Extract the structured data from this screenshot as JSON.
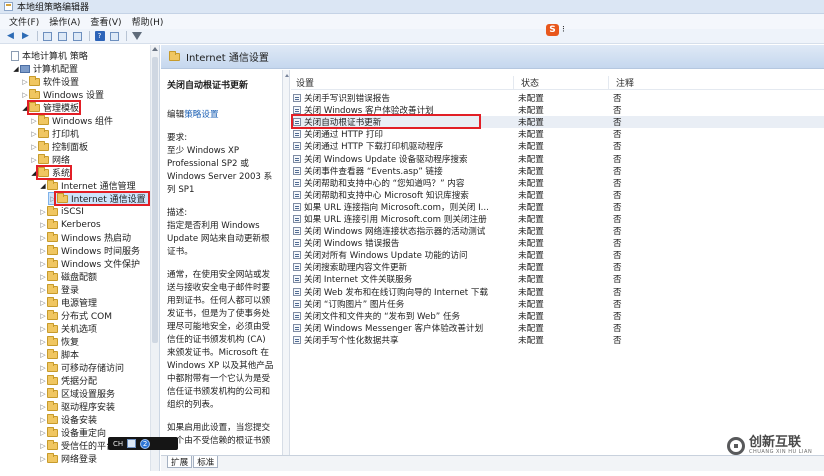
{
  "window": {
    "title": "本地组策略编辑器"
  },
  "menu": [
    "文件(F)",
    "操作(A)",
    "查看(V)",
    "帮助(H)"
  ],
  "ime": {
    "label": "S",
    "arrow": "⁝"
  },
  "tree": {
    "items": [
      {
        "label": "本地计算机 策略",
        "level": 0,
        "icon": "doc-icon"
      },
      {
        "label": "计算机配置",
        "level": 1,
        "icon": "computer-icon",
        "expanded": true
      },
      {
        "label": "软件设置",
        "level": 2,
        "icon": "folder-icon"
      },
      {
        "label": "Windows 设置",
        "level": 2,
        "icon": "folder-icon"
      },
      {
        "label": "管理模板",
        "level": 2,
        "icon": "folder-icon",
        "expanded": true
      },
      {
        "label": "Windows 组件",
        "level": 3,
        "icon": "folder-icon"
      },
      {
        "label": "打印机",
        "level": 3,
        "icon": "folder-icon"
      },
      {
        "label": "控制面板",
        "level": 3,
        "icon": "folder-icon"
      },
      {
        "label": "网络",
        "level": 3,
        "icon": "folder-icon"
      },
      {
        "label": "系统",
        "level": 3,
        "icon": "folder-icon",
        "expanded": true
      },
      {
        "label": "Internet 通信管理",
        "level": 4,
        "icon": "folder-icon",
        "expanded": true
      },
      {
        "label": "Internet 通信设置",
        "level": 5,
        "icon": "folder-icon",
        "selected": true
      },
      {
        "label": "iSCSI",
        "level": 4,
        "icon": "folder-icon"
      },
      {
        "label": "Kerberos",
        "level": 4,
        "icon": "folder-icon"
      },
      {
        "label": "Windows 热启动",
        "level": 4,
        "icon": "folder-icon"
      },
      {
        "label": "Windows 时间服务",
        "level": 4,
        "icon": "folder-icon"
      },
      {
        "label": "Windows 文件保护",
        "level": 4,
        "icon": "folder-icon"
      },
      {
        "label": "磁盘配额",
        "level": 4,
        "icon": "folder-icon"
      },
      {
        "label": "登录",
        "level": 4,
        "icon": "folder-icon"
      },
      {
        "label": "电源管理",
        "level": 4,
        "icon": "folder-icon"
      },
      {
        "label": "分布式 COM",
        "level": 4,
        "icon": "folder-icon"
      },
      {
        "label": "关机选项",
        "level": 4,
        "icon": "folder-icon"
      },
      {
        "label": "恢复",
        "level": 4,
        "icon": "folder-icon"
      },
      {
        "label": "脚本",
        "level": 4,
        "icon": "folder-icon"
      },
      {
        "label": "可移动存储访问",
        "level": 4,
        "icon": "folder-icon"
      },
      {
        "label": "凭据分配",
        "level": 4,
        "icon": "folder-icon"
      },
      {
        "label": "区域设置服务",
        "level": 4,
        "icon": "folder-icon"
      },
      {
        "label": "驱动程序安装",
        "level": 4,
        "icon": "folder-icon"
      },
      {
        "label": "设备安装",
        "level": 4,
        "icon": "folder-icon"
      },
      {
        "label": "设备重定向",
        "level": 4,
        "icon": "folder-icon"
      },
      {
        "label": "受信任的平台",
        "level": 4,
        "icon": "folder-icon"
      },
      {
        "label": "网络登录",
        "level": 4,
        "icon": "folder-icon"
      }
    ]
  },
  "content": {
    "header": "Internet 通信设置",
    "description": {
      "title": "关闭自动根证书更新",
      "edit_prefix": "编辑",
      "edit_link": "策略设置",
      "req_label": "要求:",
      "req_lines": [
        "至少 Windows XP",
        "Professional SP2 或",
        "Windows Server 2003 系",
        "列 SP1"
      ],
      "desc_label": "描述:",
      "desc_lines": [
        "指定是否利用 Windows",
        "Update 网站来自动更新根",
        "证书。"
      ],
      "body_lines": [
        "通常，在使用安全网站或发",
        "送与接收安全电子邮件时要",
        "用到证书。任何人都可以颁",
        "发证书，但是为了使事务处",
        "理尽可能地安全，必须由受",
        "信任的证书颁发机构 (CA)",
        "来颁发证书。Microsoft 在",
        "Windows XP 以及其他产品",
        "中都附带有一个它认为是受",
        "信任证书颁发机构的公司和",
        "组织的列表。"
      ],
      "tail_lines": [
        "如果启用此设置，当您提交",
        "一个由不受信赖的根证书颁"
      ]
    },
    "columns": {
      "setting": "设置",
      "state": "状态",
      "note": "注释"
    },
    "rows": [
      {
        "name": "关闭手写识别错误报告",
        "state": "未配置",
        "note": "否"
      },
      {
        "name": "关闭 Windows 客户体验改善计划",
        "state": "未配置",
        "note": "否"
      },
      {
        "name": "关闭自动根证书更新",
        "state": "未配置",
        "note": "否",
        "highlight": true
      },
      {
        "name": "关闭通过 HTTP 打印",
        "state": "未配置",
        "note": "否"
      },
      {
        "name": "关闭通过 HTTP 下载打印机驱动程序",
        "state": "未配置",
        "note": "否"
      },
      {
        "name": "关闭 Windows Update 设备驱动程序搜索",
        "state": "未配置",
        "note": "否"
      },
      {
        "name": "关闭事件查看器 “Events.asp” 链接",
        "state": "未配置",
        "note": "否"
      },
      {
        "name": "关闭帮助和支持中心的 “您知道吗？” 内容",
        "state": "未配置",
        "note": "否"
      },
      {
        "name": "关闭帮助和支持中心 Microsoft 知识库搜索",
        "state": "未配置",
        "note": "否"
      },
      {
        "name": "如果 URL 连接指向 Microsoft.com，则关闭 I...",
        "state": "未配置",
        "note": "否"
      },
      {
        "name": "如果 URL 连接引用 Microsoft.com 则关闭注册",
        "state": "未配置",
        "note": "否"
      },
      {
        "name": "关闭 Windows 网络连接状态指示器的活动测试",
        "state": "未配置",
        "note": "否"
      },
      {
        "name": "关闭 Windows 错误报告",
        "state": "未配置",
        "note": "否"
      },
      {
        "name": "关闭对所有 Windows Update 功能的访问",
        "state": "未配置",
        "note": "否"
      },
      {
        "name": "关闭搜索助理内容文件更新",
        "state": "未配置",
        "note": "否"
      },
      {
        "name": "关闭 Internet 文件关联服务",
        "state": "未配置",
        "note": "否"
      },
      {
        "name": "关闭 Web 发布和在线订购向导的 Internet 下载",
        "state": "未配置",
        "note": "否"
      },
      {
        "name": "关闭 “订购图片” 图片任务",
        "state": "未配置",
        "note": "否"
      },
      {
        "name": "关闭文件和文件夹的 “发布到 Web” 任务",
        "state": "未配置",
        "note": "否"
      },
      {
        "name": "关闭 Windows Messenger 客户体验改善计划",
        "state": "未配置",
        "note": "否"
      },
      {
        "name": "关闭手写个性化数据共享",
        "state": "未配置",
        "note": "否"
      }
    ],
    "tabs": [
      "扩展",
      "标准"
    ]
  },
  "taskbar_mini": {
    "text": "CH",
    "badge": "2"
  },
  "watermark": {
    "text": "创新互联",
    "sub": "CHUANG XIN HU LIAN"
  },
  "colors": {
    "highlight_border": "#e21f26",
    "selection": "#cde4fb",
    "link": "#1a5fb4"
  }
}
